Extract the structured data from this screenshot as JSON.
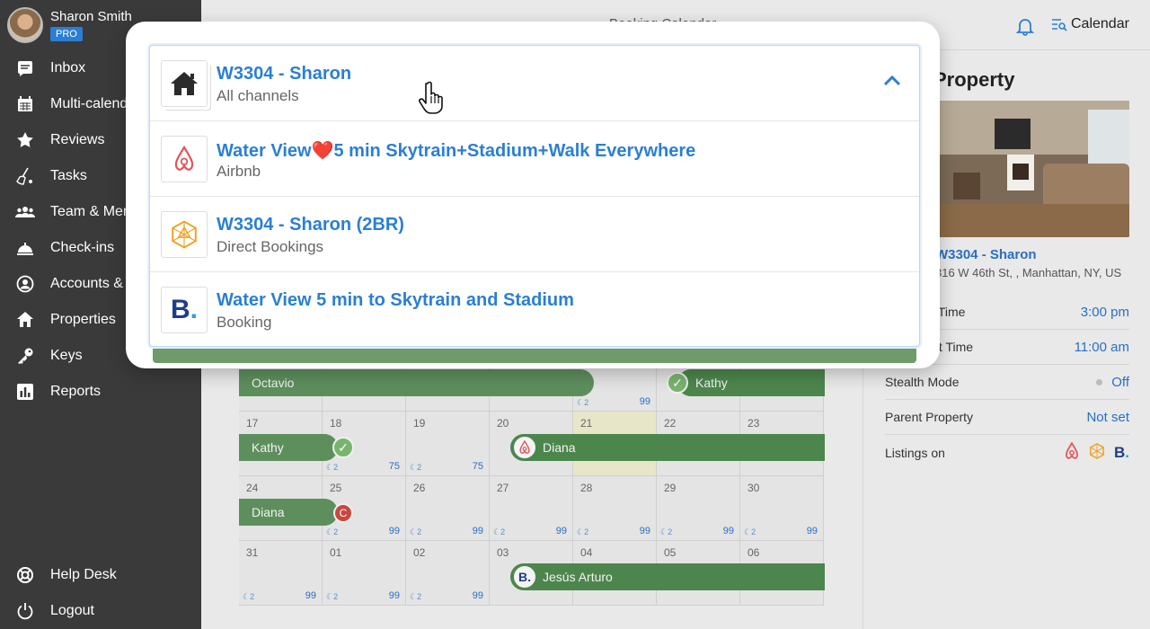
{
  "user": {
    "name": "Sharon Smith",
    "badge": "PRO"
  },
  "sidebar": {
    "items": [
      {
        "label": "Inbox",
        "icon": "inbox-icon"
      },
      {
        "label": "Multi-calendar",
        "icon": "calendar-icon"
      },
      {
        "label": "Reviews",
        "icon": "star-icon"
      },
      {
        "label": "Tasks",
        "icon": "broom-icon"
      },
      {
        "label": "Team & Members",
        "icon": "team-icon"
      },
      {
        "label": "Check-ins",
        "icon": "bell-icon"
      },
      {
        "label": "Accounts & Listings",
        "icon": "account-icon"
      },
      {
        "label": "Properties",
        "icon": "home-icon"
      },
      {
        "label": "Keys",
        "icon": "key-icon"
      },
      {
        "label": "Reports",
        "icon": "reports-icon"
      }
    ],
    "bottom": [
      {
        "label": "Help Desk",
        "icon": "lifebuoy-icon"
      },
      {
        "label": "Logout",
        "icon": "power-icon"
      }
    ]
  },
  "header": {
    "title": "Booking Calendar",
    "calendar_label": "Calendar"
  },
  "popup": {
    "items": [
      {
        "title": "W3304 - Sharon",
        "subtitle": "All channels",
        "logo": "home-icon"
      },
      {
        "title": "Water View❤️5 min Skytrain+Stadium+Walk Everywhere",
        "subtitle": "Airbnb",
        "logo": "airbnb-icon"
      },
      {
        "title": "W3304 - Sharon (2BR)",
        "subtitle": "Direct Bookings",
        "logo": "direct-bookings-icon"
      },
      {
        "title": "Water View 5 min to Skytrain and Stadium",
        "subtitle": "Booking",
        "logo": "booking-icon"
      }
    ]
  },
  "calendar": {
    "weeks": [
      {
        "days": [
          "17",
          "18",
          "19",
          "20",
          "21",
          "22",
          "23"
        ],
        "prices": [
          "",
          "75",
          "75",
          "",
          "",
          "",
          ""
        ]
      },
      {
        "days": [
          "24",
          "25",
          "26",
          "27",
          "28",
          "29",
          "30"
        ],
        "prices": [
          "",
          "99",
          "99",
          "99",
          "99",
          "99",
          "99"
        ]
      },
      {
        "days": [
          "31",
          "01",
          "02",
          "03",
          "04",
          "05",
          "06"
        ],
        "prices": [
          "99",
          "99",
          "99",
          "",
          "",
          "",
          ""
        ]
      }
    ],
    "top_row_prices": [
      "",
      "",
      "",
      "",
      "99",
      "",
      ""
    ],
    "moon": "☾2",
    "bookings": {
      "octavio": "Octavio",
      "kathy_top": "Kathy",
      "kathy": "Kathy",
      "diana_1": "Diana",
      "diana_2": "Diana",
      "jesus": "Jesús Arturo"
    }
  },
  "property": {
    "heading": "Property",
    "name": "W3304 - Sharon",
    "address": "316 W 46th St, , Manhattan, NY, US",
    "rows": [
      {
        "label": "Check-in Time",
        "value": "3:00 pm"
      },
      {
        "label": "Check-out Time",
        "value": "11:00 am"
      },
      {
        "label": "Stealth Mode",
        "value": "Off"
      },
      {
        "label": "Parent Property",
        "value": "Not set"
      },
      {
        "label": "Listings on",
        "value": ""
      }
    ]
  }
}
